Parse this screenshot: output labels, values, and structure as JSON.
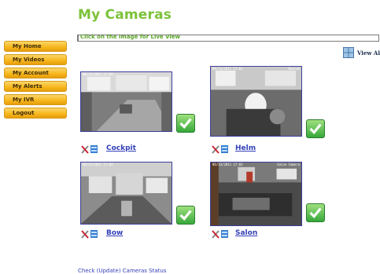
{
  "page": {
    "title": "My Cameras"
  },
  "instruction": "Click on the Image for Live View",
  "view_all": {
    "label": "View Al",
    "icon": "grid-icon"
  },
  "sidebar": {
    "items": [
      {
        "label": "My Home"
      },
      {
        "label": "My Videos"
      },
      {
        "label": "My Account"
      },
      {
        "label": "My Alerts"
      },
      {
        "label": "My IVR"
      },
      {
        "label": "Logout"
      }
    ]
  },
  "cameras": [
    {
      "name": "Cockpit",
      "timestamp": "06/13/2011 17:03",
      "tag": ""
    },
    {
      "name": "Helm",
      "timestamp": "06/13/2011 17:03",
      "tag": "Bowcam"
    },
    {
      "name": "Bow",
      "timestamp": "06/13/2011 17:03",
      "tag": ""
    },
    {
      "name": "Salon",
      "timestamp": "06/13/2011 17:03",
      "tag": "Salon Camera"
    }
  ],
  "footer": {
    "status_link": "Check (Update) Cameras Status"
  },
  "colors": {
    "title_green": "#7cc23a",
    "nav_orange": "#f7b920",
    "link_blue": "#3340b8",
    "check_green": "#36a83a"
  }
}
